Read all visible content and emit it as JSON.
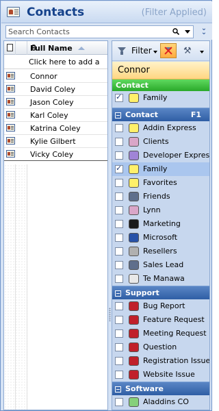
{
  "header": {
    "title": "Contacts",
    "filter_status": "(Filter Applied)"
  },
  "search": {
    "placeholder": "Search Contacts"
  },
  "list": {
    "column_name": "Full Name",
    "add_new_text": "Click here to add a",
    "rows": [
      "Connor",
      "David Coley",
      "Jason Coley",
      "Karl Coley",
      "Katrina Coley",
      "Kylie Gilbert",
      "Vicky Coley"
    ]
  },
  "filter_pane": {
    "filter_label": "Filter",
    "selected_contact": "Connor",
    "contact_section": "Contact",
    "contact_assigned": [
      {
        "label": "Family",
        "color": "#fff06a",
        "checked": true
      }
    ],
    "groups": [
      {
        "name": "Contact",
        "shortcut": "F1",
        "items": [
          {
            "label": "Addin Express",
            "color": "#fff06a",
            "checked": false
          },
          {
            "label": "Clients",
            "color": "#d9a6c8",
            "checked": false
          },
          {
            "label": "Developer Express",
            "color": "#a084d6",
            "checked": false
          },
          {
            "label": "Family",
            "color": "#fff06a",
            "checked": true,
            "selected": true
          },
          {
            "label": "Favorites",
            "color": "#fff06a",
            "checked": false
          },
          {
            "label": "Friends",
            "color": "#5f6f8c",
            "checked": false
          },
          {
            "label": "Lynn",
            "color": "#d9a6c8",
            "checked": false
          },
          {
            "label": "Marketing",
            "color": "#1a1a1a",
            "checked": false
          },
          {
            "label": "Microsoft",
            "color": "#2651a8",
            "checked": false
          },
          {
            "label": "Resellers",
            "color": "#b0b0b0",
            "checked": false
          },
          {
            "label": "Sales Lead",
            "color": "#5f6f8c",
            "checked": false
          },
          {
            "label": "Te Manawa",
            "color": "#e8e8e8",
            "checked": false
          }
        ]
      },
      {
        "name": "Support",
        "shortcut": "",
        "items": [
          {
            "label": "Bug Report",
            "color": "#c0202a",
            "checked": false
          },
          {
            "label": "Feature Request",
            "color": "#c0202a",
            "checked": false
          },
          {
            "label": "Meeting Request",
            "color": "#c0202a",
            "checked": false
          },
          {
            "label": "Question",
            "color": "#c0202a",
            "checked": false
          },
          {
            "label": "Registration Issue",
            "color": "#c0202a",
            "checked": false
          },
          {
            "label": "Website Issue",
            "color": "#c0202a",
            "checked": false
          }
        ]
      },
      {
        "name": "Software",
        "shortcut": "",
        "items": [
          {
            "label": "Aladdins CO",
            "color": "#86d07a",
            "checked": false
          }
        ]
      }
    ]
  }
}
